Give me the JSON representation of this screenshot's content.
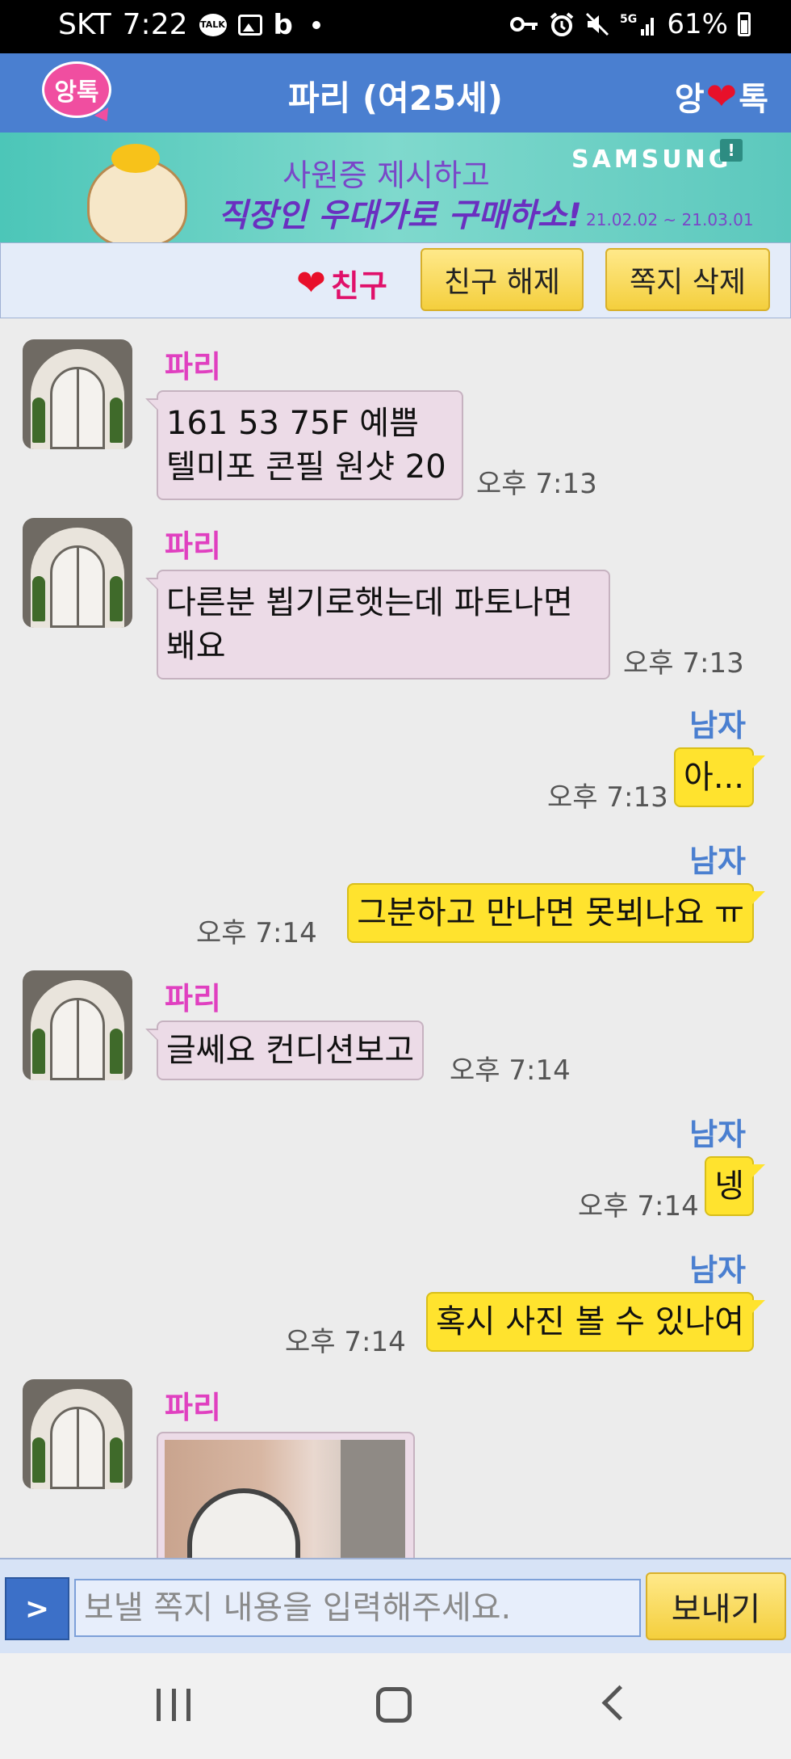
{
  "status_bar": {
    "carrier": "SKT",
    "time": "7:22",
    "notif_icons": [
      "talk-icon",
      "gallery-icon",
      "band-icon",
      "dot-icon"
    ],
    "system_icons": [
      "key-icon",
      "alarm-icon",
      "mute-icon",
      "5g-signal-icon"
    ],
    "battery": "61%"
  },
  "header": {
    "left_logo": "앙톡",
    "title": "파리 (여25세)",
    "right_logo_prefix": "앙",
    "right_logo_suffix": "톡"
  },
  "ad": {
    "line1": "사원증 제시하고",
    "line2": "직장인 우대가로 구매하소!",
    "brand": "SAMSUNG",
    "badge": "!",
    "date": "21.02.02 ~ 21.03.01"
  },
  "actions": {
    "friend_label": "친구",
    "unfriend_button": "친구 해제",
    "delete_button": "쪽지 삭제"
  },
  "messages": [
    {
      "sender": "파리",
      "lines": [
        "161 53 75F 예쁨",
        "텔미포 콘필 원샷 20"
      ],
      "time": "오후 7:13"
    },
    {
      "sender": "파리",
      "lines": [
        "다른분 뵙기로햇는데 파토나면",
        "봬요"
      ],
      "time": "오후 7:13"
    },
    {
      "sender": "남자",
      "lines": [
        "아..."
      ],
      "time": "오후 7:13"
    },
    {
      "sender": "남자",
      "lines": [
        "그분하고 만나면 못뵈나요 ㅠ"
      ],
      "time": "오후 7:14"
    },
    {
      "sender": "파리",
      "lines": [
        "글쎄요 컨디션보고"
      ],
      "time": "오후 7:14"
    },
    {
      "sender": "남자",
      "lines": [
        "넹"
      ],
      "time": "오후 7:14"
    },
    {
      "sender": "남자",
      "lines": [
        "혹시 사진 볼 수 있나여"
      ],
      "time": "오후 7:14"
    },
    {
      "sender": "파리",
      "lines": [],
      "time": ""
    }
  ],
  "input": {
    "arrow_label": ">",
    "placeholder": "보낼 쪽지 내용을 입력해주세요.",
    "send_label": "보내기"
  },
  "navbar": {
    "icons": [
      "recent-apps-icon",
      "home-icon",
      "back-icon"
    ]
  }
}
